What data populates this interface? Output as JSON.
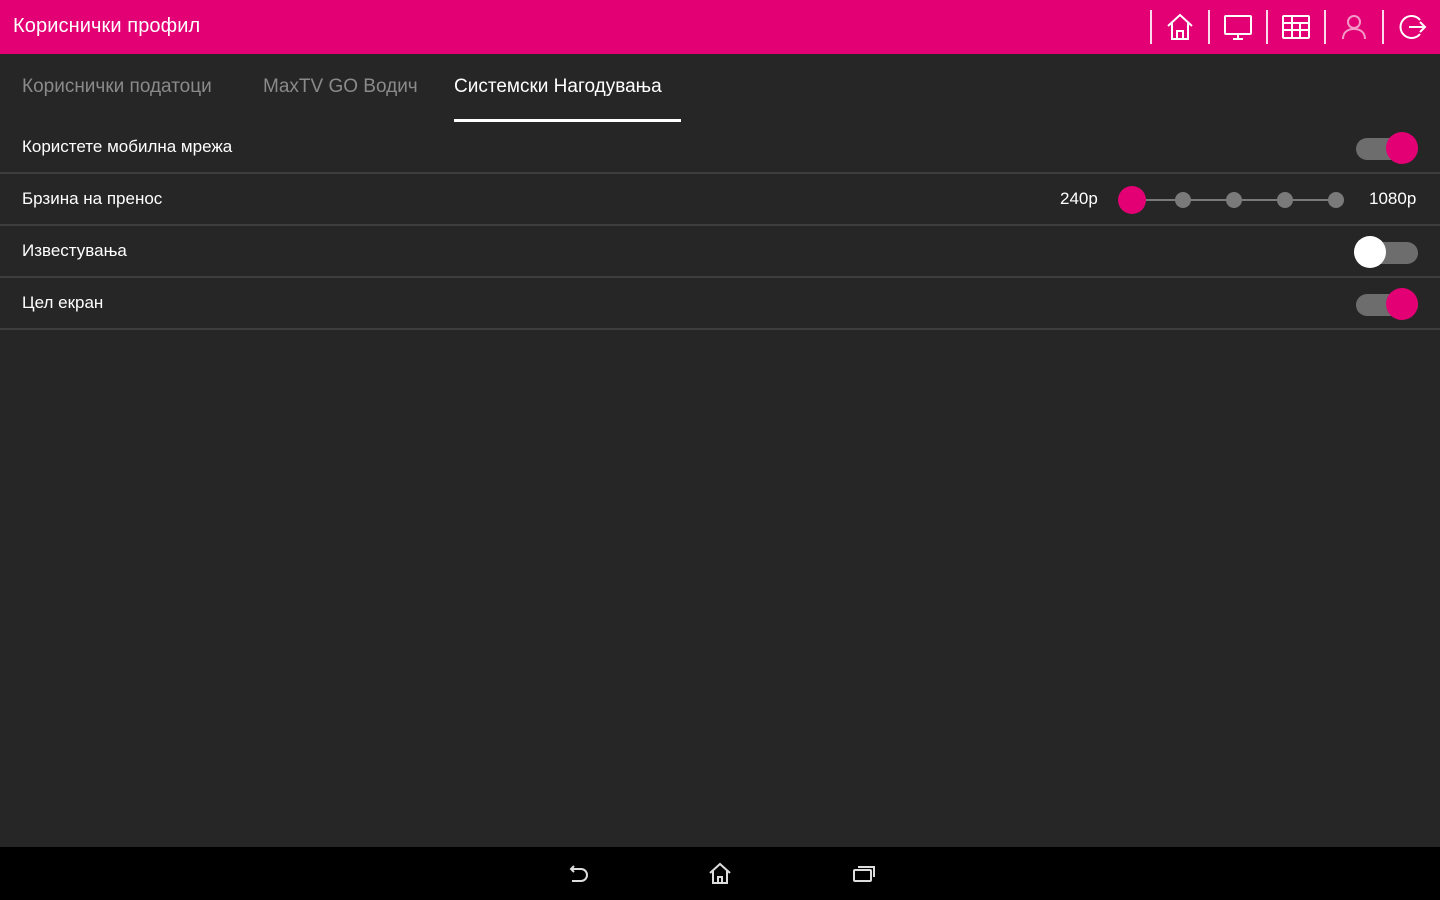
{
  "appbar": {
    "title": "Кориснички профил",
    "actions": [
      {
        "icon": "home-icon"
      },
      {
        "icon": "tv-icon"
      },
      {
        "icon": "guide-grid-icon"
      },
      {
        "icon": "user-icon"
      },
      {
        "icon": "logout-icon"
      }
    ],
    "color": "#e20074"
  },
  "tabs": [
    {
      "label": "Кориснички податоци",
      "active": false
    },
    {
      "label": "MaxTV GO Водич",
      "active": false
    },
    {
      "label": "Системски Нагодувања",
      "active": true
    }
  ],
  "settings": {
    "mobile_network": {
      "label": "Користете мобилна мрежа",
      "enabled": true
    },
    "bitrate": {
      "label": "Брзина на пренос",
      "min_label": "240p",
      "max_label": "1080p",
      "steps": 5,
      "selected_step": 0
    },
    "notifications": {
      "label": "Известувања",
      "enabled": false
    },
    "fullscreen": {
      "label": "Цел екран",
      "enabled": true
    }
  },
  "navbar": {
    "buttons": [
      {
        "icon": "back-icon"
      },
      {
        "icon": "home-icon"
      },
      {
        "icon": "recents-icon"
      }
    ]
  },
  "colors": {
    "accent": "#e20074",
    "background": "#262626",
    "divider": "#3d3d3d"
  }
}
